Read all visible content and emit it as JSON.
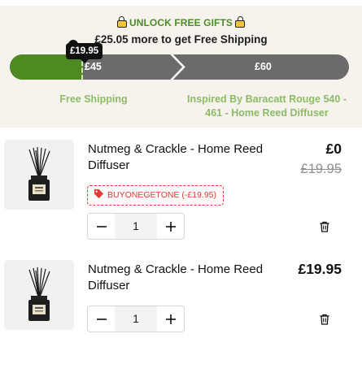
{
  "gifts": {
    "heading": "UNLOCK FREE GIFTS",
    "message": "£25.05 more to get Free Shipping",
    "progress_percent": 21.7,
    "current_label": "£19.95",
    "thresholds": [
      {
        "amount": "£45",
        "reward": "Free Shipping"
      },
      {
        "amount": "£60",
        "reward": "Inspired By Baracatt Rouge 540 - 461 - Home Reed Diffuser"
      }
    ],
    "colors": {
      "fill": "#4e8a22",
      "track": "#6b6b6b",
      "reward_text": "#8dbb69",
      "heading": "#4f8a2b"
    }
  },
  "cart": {
    "items": [
      {
        "title": "Nutmeg & Crackle - Home Reed Diffuser",
        "price": "£0",
        "compare_price": "£19.95",
        "discount": "BUYONEGETONE (-£19.95)",
        "quantity": "1",
        "image_icon": "reed-diffuser-image"
      },
      {
        "title": "Nutmeg & Crackle - Home Reed Diffuser",
        "price": "£19.95",
        "quantity": "1",
        "image_icon": "reed-diffuser-image"
      }
    ],
    "icons": {
      "minus": "minus-icon",
      "plus": "plus-icon",
      "remove": "trash-icon",
      "discount": "tag-icon"
    }
  }
}
